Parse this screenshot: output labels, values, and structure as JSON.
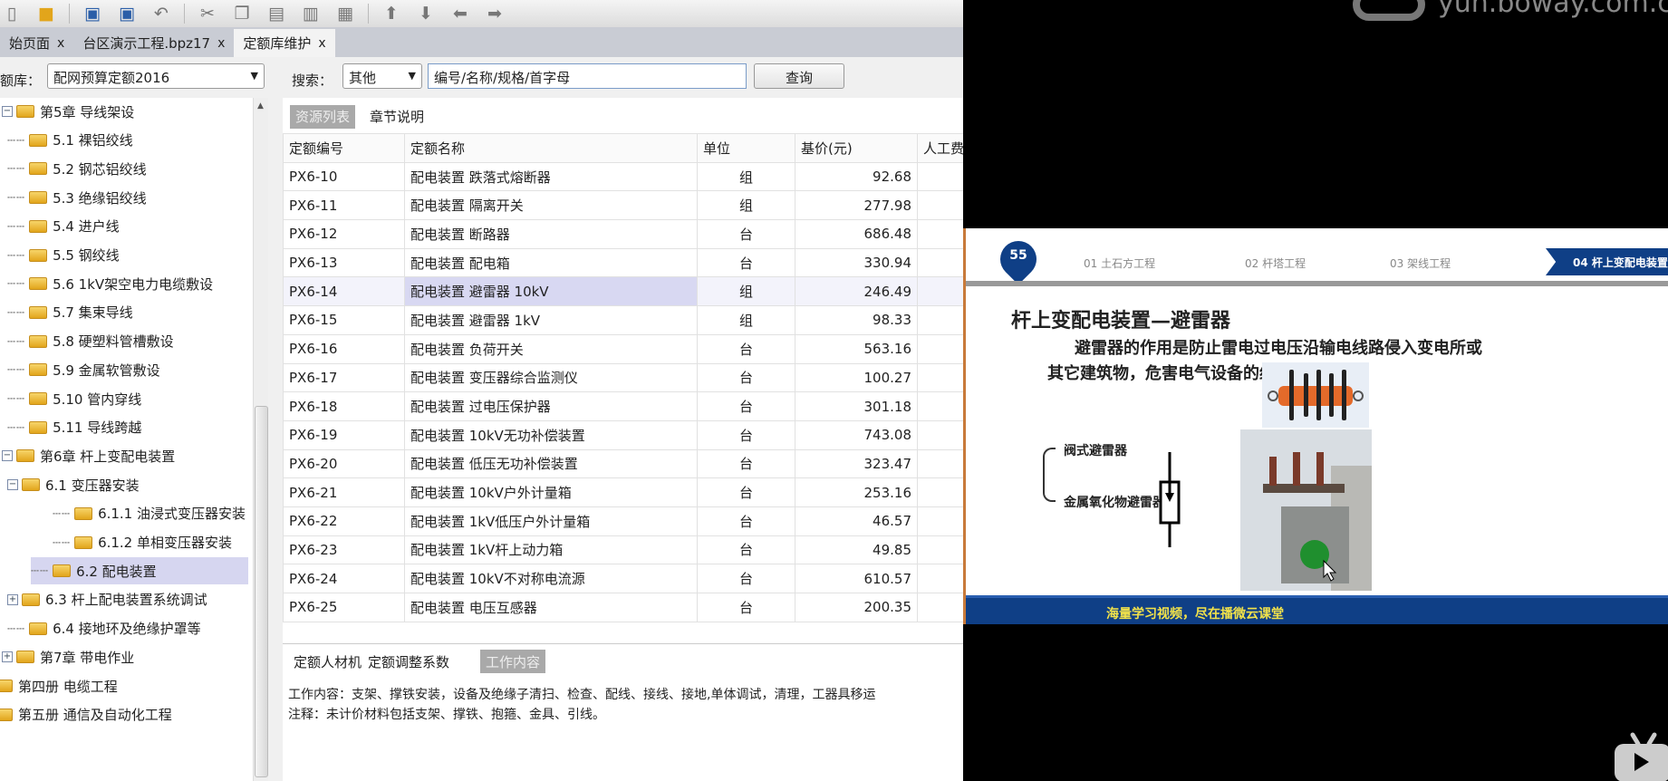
{
  "toolbar": {
    "icons": [
      "new-icon",
      "open-folder-icon",
      "save-icon",
      "save-as-icon",
      "undo-icon",
      "cut-icon",
      "copy-icon",
      "paste-icon",
      "delete-icon",
      "edit-icon",
      "move-up-icon",
      "move-down-icon",
      "move-left-icon",
      "move-right-icon"
    ]
  },
  "tabs": [
    {
      "label": "始页面"
    },
    {
      "label": "台区演示工程.bpz17"
    },
    {
      "label": "定额库维护"
    }
  ],
  "close_glyph": "x",
  "query": {
    "lib_label": "额库：",
    "lib_value": "配网预算定额2016",
    "search_label": "搜索：",
    "search_type": "其他",
    "search_placeholder": "编号/名称/规格/首字母",
    "query_button": "查询"
  },
  "tree": [
    {
      "label": "第5章 导线架设",
      "expanded": true
    },
    {
      "label": "5.1 裸铝绞线"
    },
    {
      "label": "5.2 钢芯铝绞线"
    },
    {
      "label": "5.3 绝缘铝绞线"
    },
    {
      "label": "5.4 进户线"
    },
    {
      "label": "5.5 钢绞线"
    },
    {
      "label": "5.6 1kV架空电力电缆敷设"
    },
    {
      "label": "5.7 集束导线"
    },
    {
      "label": "5.8 硬塑料管槽敷设"
    },
    {
      "label": "5.9 金属软管敷设"
    },
    {
      "label": "5.10 管内穿线"
    },
    {
      "label": "5.11 导线跨越"
    },
    {
      "label": "第6章 杆上变配电装置",
      "expanded": true
    },
    {
      "label": "6.1 变压器安装",
      "expanded": true
    },
    {
      "label": "6.1.1 油浸式变压器安装"
    },
    {
      "label": "6.1.2 单相变压器安装"
    },
    {
      "label": "6.2 配电装置",
      "selected": true
    },
    {
      "label": "6.3 杆上配电装置系统调试"
    },
    {
      "label": "6.4 接地环及绝缘护罩等"
    },
    {
      "label": "第7章 带电作业"
    },
    {
      "label": "第四册 电缆工程"
    },
    {
      "label": "第五册 通信及自动化工程"
    }
  ],
  "resource_tabs": [
    "资源列表",
    "章节说明"
  ],
  "table": {
    "headers": [
      "定额编号",
      "定额名称",
      "单位",
      "基价(元)",
      "人工费"
    ],
    "rows": [
      [
        "PX6-10",
        "配电装置 跌落式熔断器",
        "组",
        "92.68"
      ],
      [
        "PX6-11",
        "配电装置 隔离开关",
        "组",
        "277.98"
      ],
      [
        "PX6-12",
        "配电装置 断路器",
        "台",
        "686.48"
      ],
      [
        "PX6-13",
        "配电装置 配电箱",
        "台",
        "330.94"
      ],
      [
        "PX6-14",
        "配电装置 避雷器 10kV",
        "组",
        "246.49"
      ],
      [
        "PX6-15",
        "配电装置 避雷器 1kV",
        "组",
        "98.33"
      ],
      [
        "PX6-16",
        "配电装置 负荷开关",
        "台",
        "563.16"
      ],
      [
        "PX6-17",
        "配电装置 变压器综合监测仪",
        "台",
        "100.27"
      ],
      [
        "PX6-18",
        "配电装置 过电压保护器",
        "台",
        "301.18"
      ],
      [
        "PX6-19",
        "配电装置 10kV无功补偿装置",
        "台",
        "743.08"
      ],
      [
        "PX6-20",
        "配电装置 低压无功补偿装置",
        "台",
        "323.47"
      ],
      [
        "PX6-21",
        "配电装置 10kV户外计量箱",
        "台",
        "253.16"
      ],
      [
        "PX6-22",
        "配电装置 1kV低压户外计量箱",
        "台",
        "46.57"
      ],
      [
        "PX6-23",
        "配电装置 1kV杆上动力箱",
        "台",
        "49.85"
      ],
      [
        "PX6-24",
        "配电装置 10kV不对称电流源",
        "台",
        "610.57"
      ],
      [
        "PX6-25",
        "配电装置 电压互感器",
        "台",
        "200.35"
      ]
    ],
    "selected_row": "PX6-14"
  },
  "bottom_tabs": [
    "定额人材机",
    "定额调整系数",
    "工作内容"
  ],
  "work_content": "工作内容：支架、撑铁安装，设备及绝缘子清扫、检查、配线、接线、接地,单体调试，清理，工器具移运",
  "note": "注释：未计价材料包括支架、撑铁、抱箍、金具、引线。",
  "video": {
    "watermark": "yun.boway.com.cn/",
    "slide": {
      "page_number": "55",
      "nav": [
        "01 土石方工程",
        "02 杆塔工程",
        "03 架线工程",
        "04 杆上变配电装置"
      ],
      "title": "杆上变配电装置—避雷器",
      "para1": "避雷器的作用是防止雷电过电压沿输电线路侵入变电所或",
      "para2": "其它建筑物，危害电气设备的绝缘。",
      "types": [
        "阀式避雷器",
        "金属氧化物避雷器"
      ],
      "footer": "海量学习视频，尽在播微云课堂",
      "accent": "#0f3f86"
    }
  }
}
